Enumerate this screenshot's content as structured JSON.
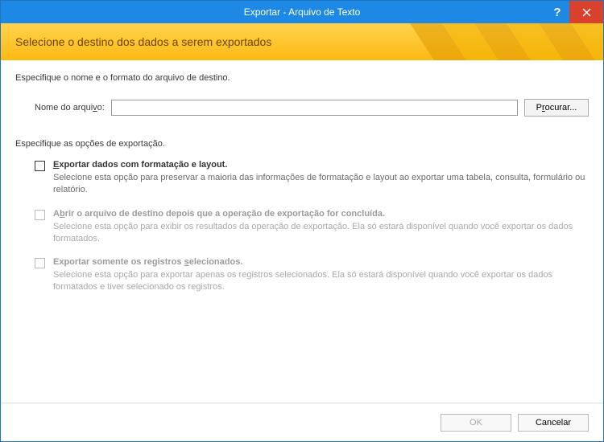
{
  "titlebar": {
    "title": "Exportar - Arquivo de Texto",
    "help": "?",
    "close": "×"
  },
  "banner": {
    "title": "Selecione o destino dos dados a serem exportados"
  },
  "file": {
    "instruction": "Especifique o nome e o formato do arquivo de destino.",
    "label_prefix": "Nome do arqui",
    "label_key": "v",
    "label_suffix": "o:",
    "value": "",
    "browse_prefix": "P",
    "browse_key": "r",
    "browse_suffix": "ocurar..."
  },
  "options": {
    "header": "Especifique as opções de exportação.",
    "items": [
      {
        "title_key": "E",
        "title_rest": "xportar dados com formatação e layout.",
        "desc": "Selecione esta opção para preservar a maioria das informações de formatação e layout ao exportar uma tabela, consulta, formulário ou relatório."
      },
      {
        "title_prefix": "A",
        "title_key": "b",
        "title_rest": "rir o arquivo de destino depois que a operação de exportação for concluída.",
        "desc": "Selecione esta opção para exibir os resultados da operação de exportação. Ela só estará disponível quando você exportar os dados formatados."
      },
      {
        "title_prefix": "Exportar somente os registros ",
        "title_key": "s",
        "title_rest": "elecionados.",
        "desc": "Selecione esta opção para exportar apenas os registros selecionados. Ela só estará disponível quando você exportar os dados formatados e tiver selecionado os registros."
      }
    ]
  },
  "footer": {
    "ok": "OK",
    "cancel": "Cancelar"
  }
}
